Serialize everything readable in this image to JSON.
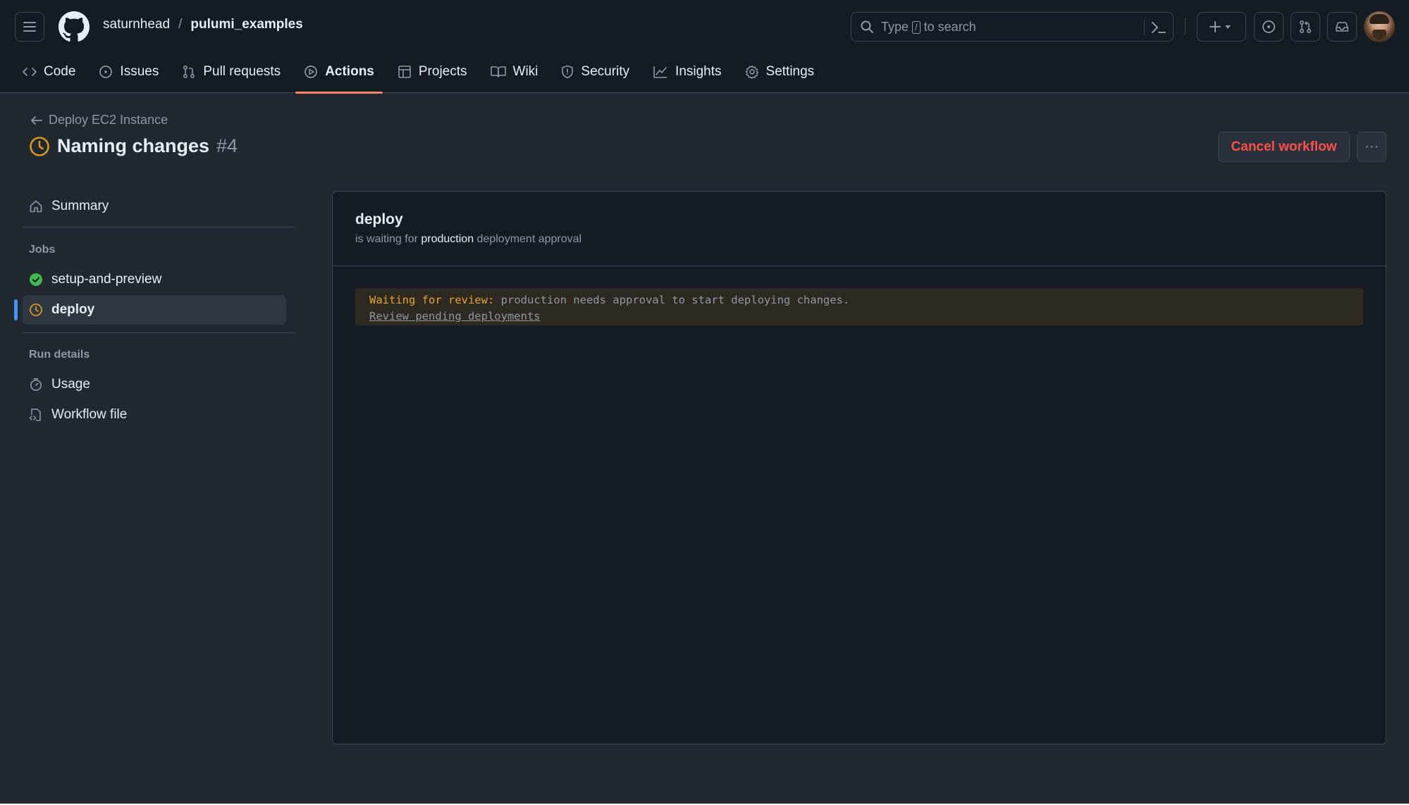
{
  "header": {
    "owner": "saturnhead",
    "separator": "/",
    "repo": "pulumi_examples",
    "search": {
      "prefix": "Type",
      "key": "/",
      "suffix": "to search"
    }
  },
  "tabs": [
    {
      "label": "Code",
      "icon": "code-icon"
    },
    {
      "label": "Issues",
      "icon": "issue-icon"
    },
    {
      "label": "Pull requests",
      "icon": "pull-request-icon"
    },
    {
      "label": "Actions",
      "icon": "play-icon",
      "active": true
    },
    {
      "label": "Projects",
      "icon": "table-icon"
    },
    {
      "label": "Wiki",
      "icon": "book-icon"
    },
    {
      "label": "Security",
      "icon": "shield-icon"
    },
    {
      "label": "Insights",
      "icon": "graph-icon"
    },
    {
      "label": "Settings",
      "icon": "gear-icon"
    }
  ],
  "run": {
    "workflow_link": "Deploy EC2 Instance",
    "title": "Naming changes",
    "number": "#4",
    "status": "waiting",
    "cancel_label": "Cancel workflow",
    "more_label": "···"
  },
  "sidebar": {
    "summary": "Summary",
    "jobs_heading": "Jobs",
    "jobs": [
      {
        "label": "setup-and-preview",
        "status": "success"
      },
      {
        "label": "deploy",
        "status": "waiting",
        "selected": true
      }
    ],
    "run_details_heading": "Run details",
    "details": [
      {
        "label": "Usage",
        "icon": "stopwatch-icon"
      },
      {
        "label": "Workflow file",
        "icon": "file-code-icon"
      }
    ]
  },
  "job": {
    "name": "deploy",
    "sub_prefix": "is waiting for",
    "environment": "production",
    "sub_suffix": "deployment approval",
    "notice_label": "Waiting for review:",
    "notice_text": "production needs approval to start deploying changes.",
    "review_link": "Review pending deployments"
  },
  "colors": {
    "accent": "#4493f8",
    "danger": "#f85149",
    "success": "#3fb950",
    "waiting": "#d29922",
    "tab_underline": "#f78166"
  }
}
